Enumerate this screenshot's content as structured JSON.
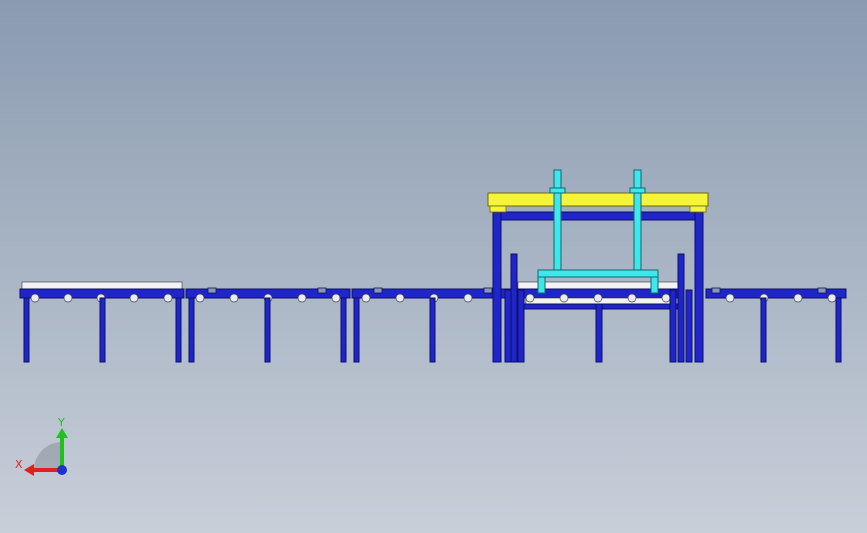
{
  "viewport": {
    "background_top": "#8a9bb0",
    "background_bottom": "#c8cfd9",
    "colors": {
      "frame_blue": "#1f25c8",
      "frame_dark": "#0b0f6a",
      "platform_yellow": "#f6f43a",
      "lift_cyan": "#3fe6ea",
      "panel_white": "#f3f3f3"
    }
  },
  "triad": {
    "x_label": "X",
    "y_label": "Y",
    "x_color": "#e02020",
    "y_color": "#20c020",
    "z_color": "#2030d0"
  }
}
